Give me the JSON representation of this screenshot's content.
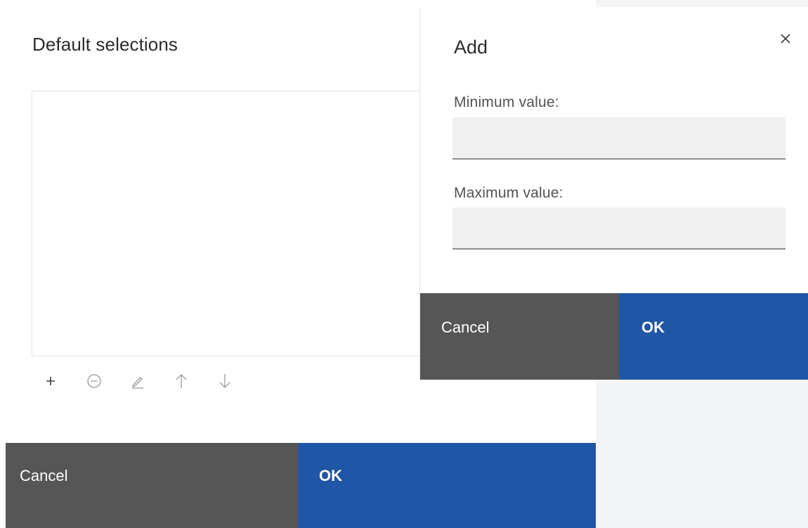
{
  "base_dialog": {
    "title": "Default selections",
    "toolbar": {
      "icons": [
        "add-icon",
        "remove-icon",
        "edit-icon",
        "move-up-icon",
        "move-down-icon"
      ]
    },
    "footer": {
      "cancel_label": "Cancel",
      "ok_label": "OK"
    }
  },
  "add_panel": {
    "title": "Add",
    "close_icon": "close-icon",
    "min_label": "Minimum value:",
    "min_value": "",
    "max_label": "Maximum value:",
    "max_value": "",
    "footer": {
      "cancel_label": "Cancel",
      "ok_label": "OK"
    }
  },
  "colors": {
    "primary": "#1f56a5",
    "secondary": "#565656",
    "field_bg": "#f1f1f1"
  }
}
